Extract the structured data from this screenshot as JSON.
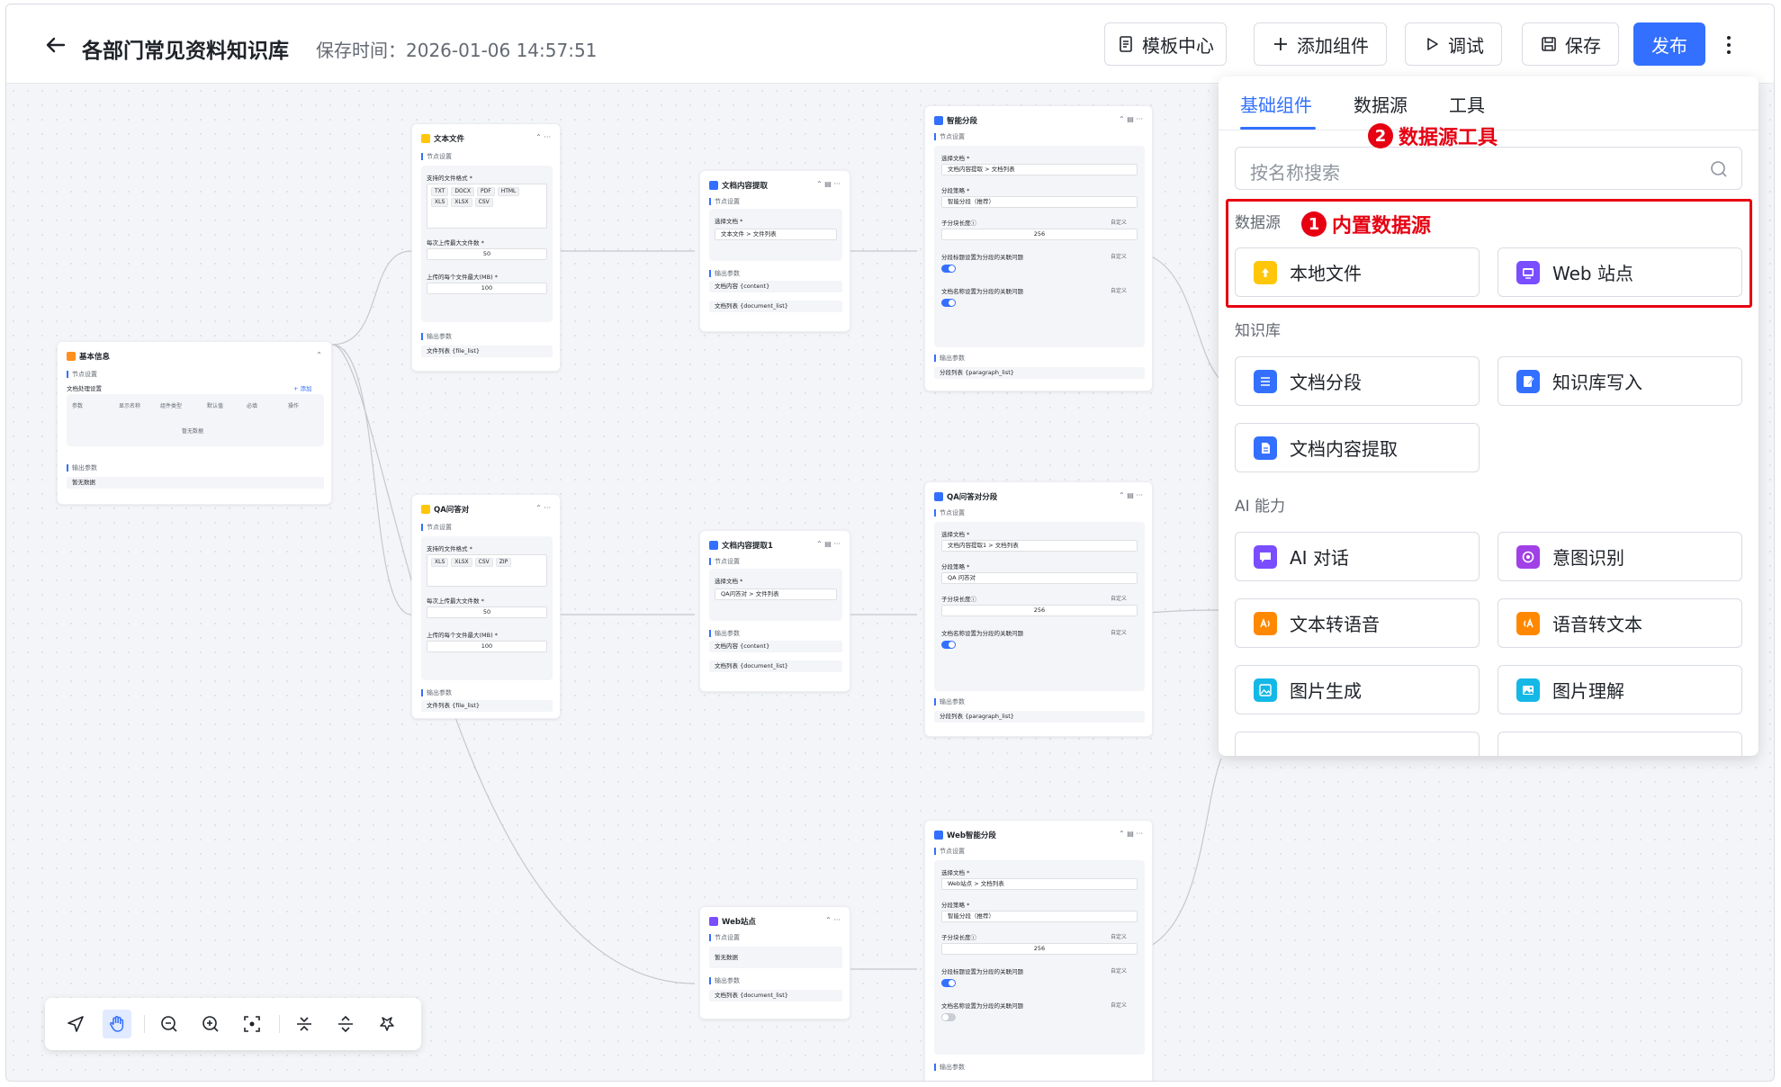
{
  "header": {
    "title": "各部门常见资料知识库",
    "save_time": "保存时间：2026-01-06 14:57:51",
    "buttons": {
      "template_center": "模板中心",
      "add_component": "添加组件",
      "debug": "调试",
      "save": "保存",
      "publish": "发布"
    }
  },
  "panel": {
    "tabs": [
      "基础组件",
      "数据源",
      "工具"
    ],
    "active_tab": "基础组件",
    "search_placeholder": "按名称搜索",
    "categories": {
      "data_source": "数据源",
      "knowledge_base": "知识库",
      "ai": "AI 能力"
    },
    "items": {
      "local_file": "本地文件",
      "web_site": "Web 站点",
      "doc_segment": "文档分段",
      "kb_write": "知识库写入",
      "doc_extract": "文档内容提取",
      "ai_chat": "AI 对话",
      "intent": "意图识别",
      "tts": "文本转语音",
      "stt": "语音转文本",
      "img_gen": "图片生成",
      "img_understand": "图片理解"
    },
    "annotations": {
      "builtin": {
        "num": "1",
        "text": "内置数据源"
      },
      "tools": {
        "num": "2",
        "text": "数据源工具"
      }
    },
    "colors": {
      "accent": "#3370ff",
      "annotation": "#e60012"
    }
  },
  "nodes": {
    "base_info": {
      "title": "基本信息",
      "node_settings": "节点设置",
      "doc_settings": "文档处理设置",
      "add": "+ 添加",
      "columns": [
        "参数",
        "显示名称",
        "组件类型",
        "默认值",
        "必填",
        "操作"
      ],
      "empty": "暂无数据",
      "output": "输出参数",
      "output_value": "暂无数据"
    },
    "text_file": {
      "title": "文本文件",
      "node_settings": "节点设置",
      "formats_label": "支持的文件格式 *",
      "formats": [
        "TXT",
        "DOCX",
        "PDF",
        "HTML",
        "XLS",
        "XLSX",
        "CSV"
      ],
      "max_files_label": "每次上传最大文件数 *",
      "max_files": "50",
      "max_size_label": "上传的每个文件最大(MB) *",
      "max_size": "100",
      "output": "输出参数",
      "output_value": "文件列表 {file_list}"
    },
    "qa_file": {
      "title": "QA问答对",
      "node_settings": "节点设置",
      "formats_label": "支持的文件格式 *",
      "formats": [
        "XLS",
        "XLSX",
        "CSV",
        "ZIP"
      ],
      "max_files_label": "每次上传最大文件数 *",
      "max_files": "50",
      "max_size_label": "上传的每个文件最大(MB) *",
      "max_size": "100",
      "output": "输出参数",
      "output_value": "文件列表 {file_list}"
    },
    "extract": {
      "title": "文档内容提取",
      "node_settings": "节点设置",
      "select_label": "选择文档 *",
      "select_value": "文本文件 > 文件列表",
      "output": "输出参数",
      "out1": "文档内容 {content}",
      "out2": "文档列表 {document_list}"
    },
    "extract1": {
      "title": "文档内容提取1",
      "node_settings": "节点设置",
      "select_label": "选择文档 *",
      "select_value": "QA问答对 > 文件列表",
      "output": "输出参数",
      "out1": "文档内容 {content}",
      "out2": "文档列表 {document_list}"
    },
    "web_site": {
      "title": "Web站点",
      "node_settings": "节点设置",
      "empty": "暂无数据",
      "output": "输出参数",
      "out1": "文档列表 {document_list}"
    },
    "smart_seg": {
      "title": "智能分段",
      "node_settings": "节点设置",
      "select_label": "选择文档 *",
      "select_value": "文档内容提取 > 文档列表",
      "strategy_label": "分段策略 *",
      "strategy_value": "智能分段（推荐）",
      "chunk_label": "子分块长度ⓘ",
      "chunk_value": "256",
      "custom": "自定义",
      "q1": "分段标题设置为分段的关联问题",
      "q2": "文档名称设置为分段的关联问题",
      "output": "输出参数",
      "out1": "分段列表 {paragraph_list}"
    },
    "qa_seg": {
      "title": "QA问答对分段",
      "node_settings": "节点设置",
      "select_label": "选择文档 *",
      "select_value": "文档内容提取1 > 文档列表",
      "strategy_label": "分段策略 *",
      "strategy_value": "QA 问答对",
      "chunk_label": "子分块长度ⓘ",
      "chunk_value": "256",
      "custom": "自定义",
      "q2": "文档名称设置为分段的关联问题",
      "output": "输出参数",
      "out1": "分段列表 {paragraph_list}"
    },
    "web_seg": {
      "title": "Web智能分段",
      "node_settings": "节点设置",
      "select_label": "选择文档 *",
      "select_value": "Web站点 > 文档列表",
      "strategy_label": "分段策略 *",
      "strategy_value": "智能分段（推荐）",
      "chunk_label": "子分块长度ⓘ",
      "chunk_value": "256",
      "custom": "自定义",
      "q1": "分段标题设置为分段的关联问题",
      "q2": "文档名称设置为分段的关联问题",
      "output": "输出参数"
    }
  }
}
